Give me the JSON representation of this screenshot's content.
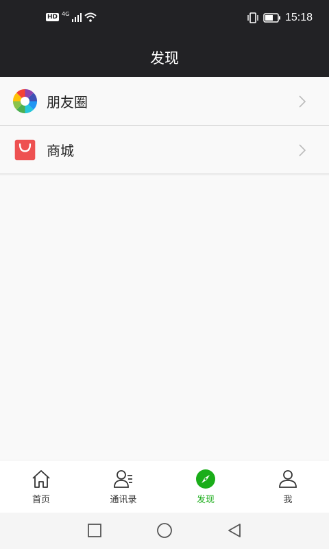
{
  "status_bar": {
    "hd": "HD",
    "network": "4G",
    "time": "15:18"
  },
  "header": {
    "title": "发现"
  },
  "list": {
    "items": [
      {
        "label": "朋友圈",
        "icon": "moments-aperture-icon"
      },
      {
        "label": "商城",
        "icon": "shopping-bag-icon"
      }
    ]
  },
  "tabbar": {
    "tabs": [
      {
        "label": "首页",
        "icon": "home-icon"
      },
      {
        "label": "通讯录",
        "icon": "contacts-icon"
      },
      {
        "label": "发现",
        "icon": "compass-icon",
        "active": true
      },
      {
        "label": "我",
        "icon": "person-icon"
      }
    ]
  },
  "colors": {
    "header_bg": "#222225",
    "accent": "#1aad19",
    "shop_red": "#ee5151"
  }
}
